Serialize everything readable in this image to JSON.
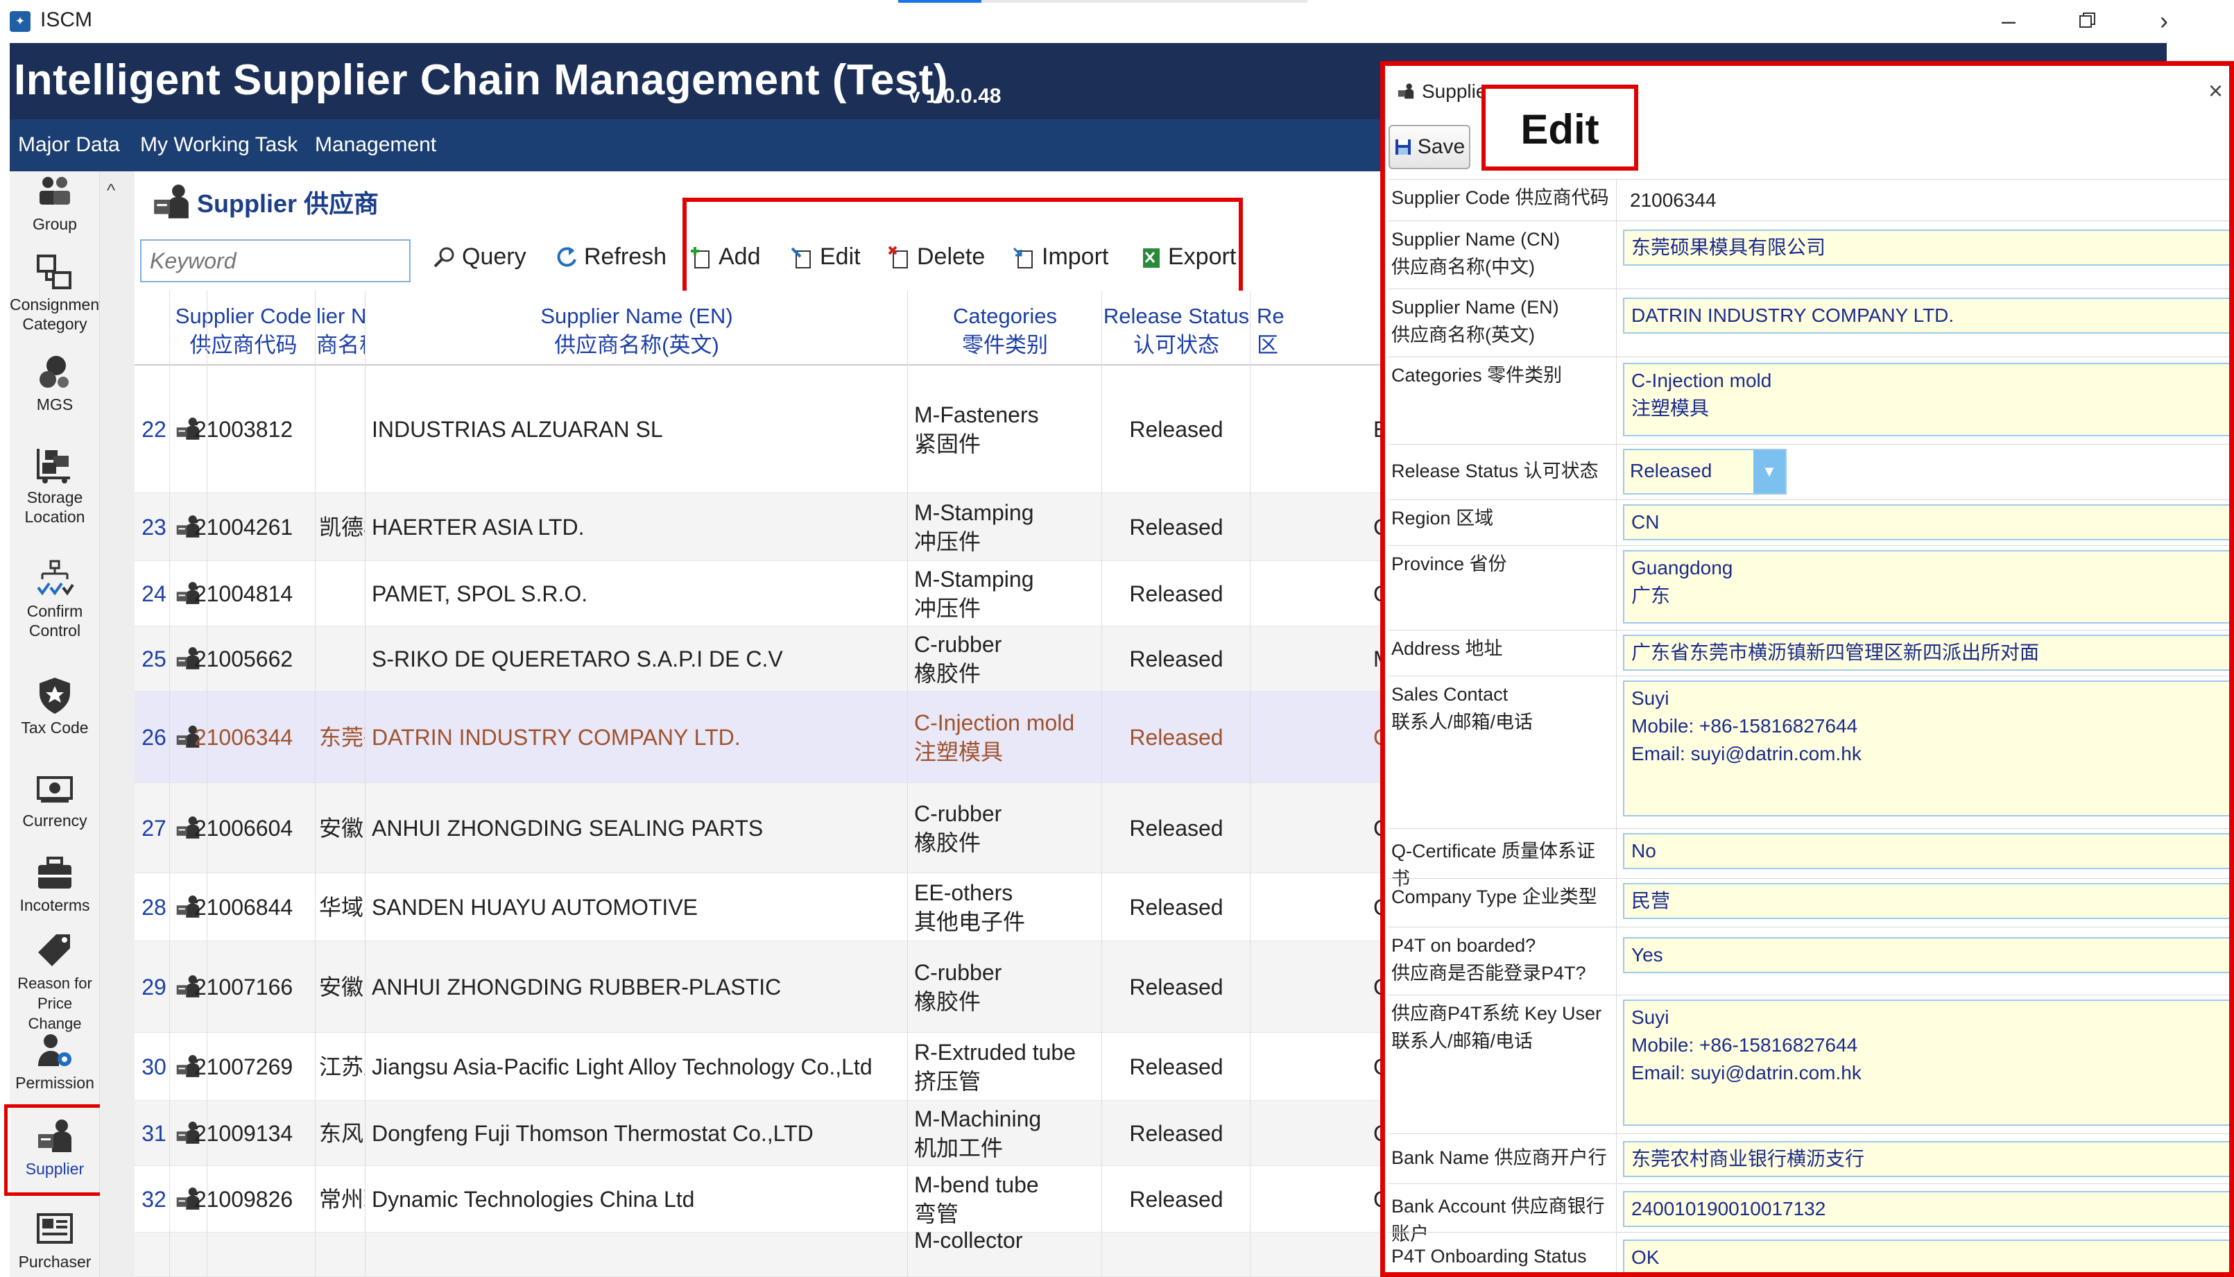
{
  "window": {
    "app_title": "ISCM",
    "app_icon": "app-logo-icon",
    "controls": [
      "minimize-icon",
      "maximize-icon",
      "chevron-right-icon"
    ]
  },
  "header": {
    "title": "Intelligent Supplier Chain Management (Test)",
    "version": "v 1.0.0.48"
  },
  "menu": {
    "items": [
      "Major Data",
      "My Working Task",
      "Management"
    ]
  },
  "sidebar": {
    "items": [
      {
        "label": "Group",
        "icon": "group-icon"
      },
      {
        "label": "Consignment Category",
        "icon": "consignment-category-icon"
      },
      {
        "label": "MGS",
        "icon": "mgs-icon"
      },
      {
        "label": "Storage Location",
        "icon": "storage-location-icon"
      },
      {
        "label": "Confirm Control",
        "icon": "confirm-control-icon"
      },
      {
        "label": "Tax Code",
        "icon": "tax-code-icon"
      },
      {
        "label": "Currency",
        "icon": "currency-icon"
      },
      {
        "label": "Incoterms",
        "icon": "incoterms-icon"
      },
      {
        "label": "Reason for Price Change",
        "icon": "price-change-tag-icon"
      },
      {
        "label": "Permission",
        "icon": "permission-icon"
      },
      {
        "label": "Supplier",
        "icon": "supplier-icon"
      },
      {
        "label": "Purchaser",
        "icon": "purchaser-icon"
      }
    ]
  },
  "page": {
    "title": "Supplier 供应商"
  },
  "toolbar": {
    "keyword_placeholder": "Keyword",
    "query": "Query",
    "refresh": "Refresh",
    "add": "Add",
    "edit": "Edit",
    "delete": "Delete",
    "import": "Import",
    "export": "Export"
  },
  "grid": {
    "headers": [
      {
        "en": "Supplier Code",
        "cn": "供应商代码"
      },
      {
        "en": "lier Name",
        "cn": "商名称(中"
      },
      {
        "en": "Supplier Name (EN)",
        "cn": "供应商名称(英文)"
      },
      {
        "en": "Categories",
        "cn": "零件类别"
      },
      {
        "en": "Release Status",
        "cn": "认可状态"
      },
      {
        "en": "Re",
        "cn": "区"
      }
    ],
    "rows": [
      {
        "num": "22",
        "code": "21003812",
        "cn": "",
        "en": "INDUSTRIAS ALZUARAN SL",
        "cat1": "M-Fasteners",
        "cat2": "紧固件",
        "status": "Released",
        "region": "E"
      },
      {
        "num": "23",
        "code": "21004261",
        "cn": "凯德机械",
        "en": "HAERTER ASIA LTD.",
        "cat1": "M-Stamping",
        "cat2": "冲压件",
        "status": "Released",
        "region": "C"
      },
      {
        "num": "24",
        "code": "21004814",
        "cn": "",
        "en": "PAMET,  SPOL S.R.O.",
        "cat1": "M-Stamping",
        "cat2": "冲压件",
        "status": "Released",
        "region": "C"
      },
      {
        "num": "25",
        "code": "21005662",
        "cn": "",
        "en": "S-RIKO DE QUERETARO S.A.P.I DE C.V",
        "cat1": "C-rubber",
        "cat2": "橡胶件",
        "status": "Released",
        "region": "M"
      },
      {
        "num": "26",
        "code": "21006344",
        "cn": "东莞硕果",
        "en": "DATRIN INDUSTRY COMPANY LTD.",
        "cat1": "C-Injection mold",
        "cat2": "注塑模具",
        "status": "Released",
        "region": "C"
      },
      {
        "num": "27",
        "code": "21006604",
        "cn": "安徽中鼎",
        "en": "ANHUI ZHONGDING SEALING PARTS",
        "cat1": "C-rubber",
        "cat2": "橡胶件",
        "status": "Released",
        "region": "C"
      },
      {
        "num": "28",
        "code": "21006844",
        "cn": "华域三电",
        "en": "SANDEN HUAYU AUTOMOTIVE",
        "cat1": "EE-others",
        "cat2": "其他电子件",
        "status": "Released",
        "region": "C"
      },
      {
        "num": "29",
        "code": "21007166",
        "cn": "安徽中鼎",
        "en": "ANHUI ZHONGDING RUBBER-PLASTIC",
        "cat1": "C-rubber",
        "cat2": "橡胶件",
        "status": "Released",
        "region": "C"
      },
      {
        "num": "30",
        "code": "21007269",
        "cn": "江苏亚太",
        "en": "Jiangsu Asia-Pacific Light  Alloy Technology Co.,Ltd",
        "cat1": "R-Extruded tube",
        "cat2": "挤压管",
        "status": "Released",
        "region": "C"
      },
      {
        "num": "31",
        "code": "21009134",
        "cn": "东风富士",
        "en": "Dongfeng Fuji Thomson Thermostat Co.,LTD",
        "cat1": "M-Machining",
        "cat2": "机加工件",
        "status": "Released",
        "region": "C"
      },
      {
        "num": "32",
        "code": "21009826",
        "cn": "常州瑞信",
        "en": "Dynamic Technologies China Ltd",
        "cat1": "M-bend tube",
        "cat2": "弯管",
        "status": "Released",
        "region": "C"
      },
      {
        "num": "",
        "code": "",
        "cn": "",
        "en": "",
        "cat1": "M-collector",
        "cat2": "",
        "status": "",
        "region": ""
      }
    ]
  },
  "panel": {
    "title": "Supplier",
    "edit_label": "Edit",
    "save": "Save",
    "fields": {
      "code_label": "Supplier Code 供应商代码",
      "code": "21006344",
      "name_cn_label1": "Supplier Name (CN)",
      "name_cn_label2": "供应商名称(中文)",
      "name_cn": "东莞硕果模具有限公司",
      "name_en_label1": "Supplier Name (EN)",
      "name_en_label2": "供应商名称(英文)",
      "name_en": "DATRIN INDUSTRY COMPANY LTD.",
      "categories_label": "Categories 零件类别",
      "categories_1": "C-Injection mold",
      "categories_2": "注塑模具",
      "release_label": "Release Status 认可状态",
      "release": "Released",
      "region_label": "Region 区域",
      "region": "CN",
      "province_label": "Province 省份",
      "province_1": "Guangdong",
      "province_2": "广东",
      "address_label": "Address 地址",
      "address": "广东省东莞市横沥镇新四管理区新四派出所对面",
      "sales_label1": "Sales Contact",
      "sales_label2": "联系人/邮箱/电话",
      "sales_1": "Suyi",
      "sales_2": "Mobile:  +86-15816827644",
      "sales_3": "Email:  suyi@datrin.com.hk",
      "qcert_label": "Q-Certificate 质量体系证书",
      "qcert": "No",
      "company_type_label": "Company Type 企业类型",
      "company_type": "民营",
      "p4t_label1": "P4T on boarded?",
      "p4t_label2": "供应商是否能登录P4T?",
      "p4t": "Yes",
      "keyuser_label1": "供应商P4T系统 Key User",
      "keyuser_label2": "联系人/邮箱/电话",
      "keyuser_1": "Suyi",
      "keyuser_2": "Mobile:  +86-15816827644",
      "keyuser_3": "Email:  suyi@datrin.com.hk",
      "bank_name_label": "Bank Name 供应商开户行",
      "bank_name": "东莞农村商业银行横沥支行",
      "bank_account_label": "Bank Account 供应商银行账户",
      "bank_account": "240010190010017132",
      "p4t_status_label": "P4T Onboarding Status",
      "p4t_status": "OK"
    }
  }
}
